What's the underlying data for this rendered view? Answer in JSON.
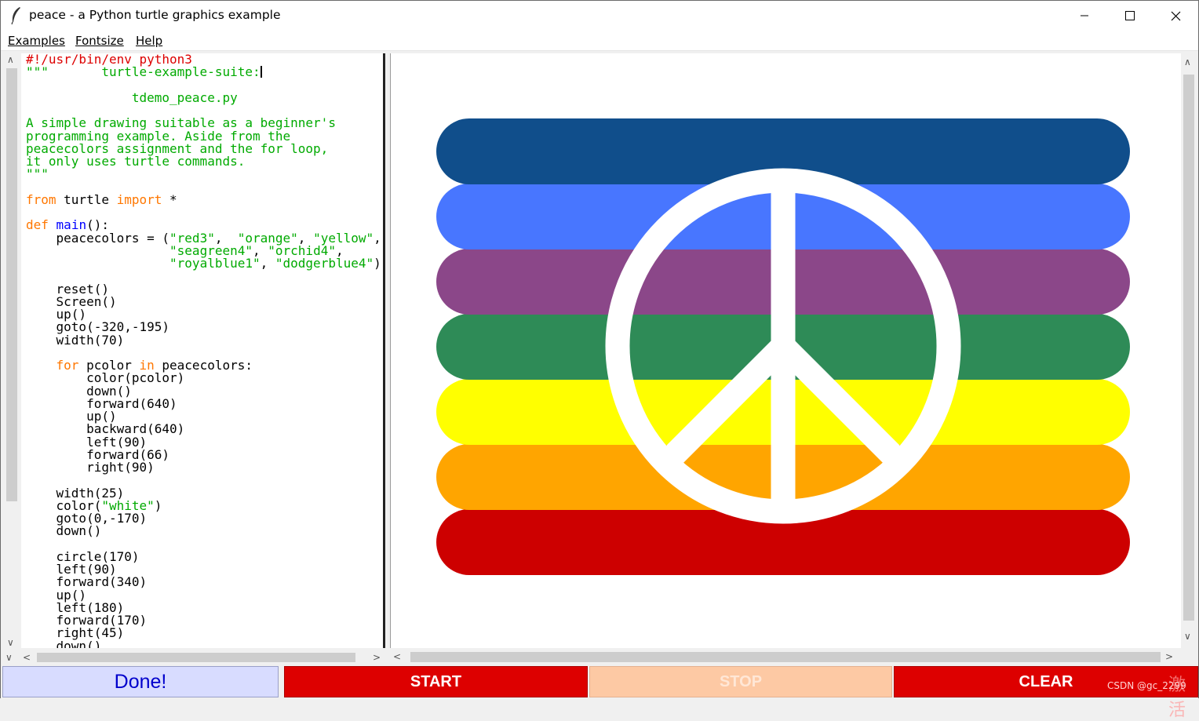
{
  "window": {
    "title": "peace - a Python turtle graphics example",
    "icon": "feather-icon"
  },
  "menu": {
    "examples": "Examples",
    "fontsize": "Fontsize",
    "help": "Help"
  },
  "code_lines": [
    [
      [
        "red",
        "#!/usr/bin/env python3"
      ]
    ],
    [
      [
        "grn",
        "\"\"\"       turtle-example-suite:"
      ],
      [
        "caret",
        ""
      ]
    ],
    [],
    [
      [
        "grn",
        "              tdemo_peace.py"
      ]
    ],
    [],
    [
      [
        "grn",
        "A simple drawing suitable as a beginner's"
      ]
    ],
    [
      [
        "grn",
        "programming example. Aside from the"
      ]
    ],
    [
      [
        "grn",
        "peacecolors assignment and the for loop,"
      ]
    ],
    [
      [
        "grn",
        "it only uses turtle commands."
      ]
    ],
    [
      [
        "grn",
        "\"\"\""
      ]
    ],
    [],
    [
      [
        "org",
        "from"
      ],
      [
        "txt",
        " turtle "
      ],
      [
        "org",
        "import"
      ],
      [
        "txt",
        " *"
      ]
    ],
    [],
    [
      [
        "org",
        "def"
      ],
      [
        "txt",
        " "
      ],
      [
        "blu",
        "main"
      ],
      [
        "txt",
        "():"
      ]
    ],
    [
      [
        "txt",
        "    peacecolors = ("
      ],
      [
        "grn",
        "\"red3\""
      ],
      [
        "txt",
        ",  "
      ],
      [
        "grn",
        "\"orange\""
      ],
      [
        "txt",
        ", "
      ],
      [
        "grn",
        "\"yellow\""
      ],
      [
        "txt",
        ","
      ]
    ],
    [
      [
        "txt",
        "                   "
      ],
      [
        "grn",
        "\"seagreen4\""
      ],
      [
        "txt",
        ", "
      ],
      [
        "grn",
        "\"orchid4\""
      ],
      [
        "txt",
        ","
      ]
    ],
    [
      [
        "txt",
        "                   "
      ],
      [
        "grn",
        "\"royalblue1\""
      ],
      [
        "txt",
        ", "
      ],
      [
        "grn",
        "\"dodgerblue4\""
      ],
      [
        "txt",
        ")"
      ]
    ],
    [],
    [
      [
        "txt",
        "    reset()"
      ]
    ],
    [
      [
        "txt",
        "    Screen()"
      ]
    ],
    [
      [
        "txt",
        "    up()"
      ]
    ],
    [
      [
        "txt",
        "    goto(-320,-195)"
      ]
    ],
    [
      [
        "txt",
        "    width(70)"
      ]
    ],
    [],
    [
      [
        "txt",
        "    "
      ],
      [
        "org",
        "for"
      ],
      [
        "txt",
        " pcolor "
      ],
      [
        "org",
        "in"
      ],
      [
        "txt",
        " peacecolors:"
      ]
    ],
    [
      [
        "txt",
        "        color(pcolor)"
      ]
    ],
    [
      [
        "txt",
        "        down()"
      ]
    ],
    [
      [
        "txt",
        "        forward(640)"
      ]
    ],
    [
      [
        "txt",
        "        up()"
      ]
    ],
    [
      [
        "txt",
        "        backward(640)"
      ]
    ],
    [
      [
        "txt",
        "        left(90)"
      ]
    ],
    [
      [
        "txt",
        "        forward(66)"
      ]
    ],
    [
      [
        "txt",
        "        right(90)"
      ]
    ],
    [],
    [
      [
        "txt",
        "    width(25)"
      ]
    ],
    [
      [
        "txt",
        "    color("
      ],
      [
        "grn",
        "\"white\""
      ],
      [
        "txt",
        ")"
      ]
    ],
    [
      [
        "txt",
        "    goto(0,-170)"
      ]
    ],
    [
      [
        "txt",
        "    down()"
      ]
    ],
    [],
    [
      [
        "txt",
        "    circle(170)"
      ]
    ],
    [
      [
        "txt",
        "    left(90)"
      ]
    ],
    [
      [
        "txt",
        "    forward(340)"
      ]
    ],
    [
      [
        "txt",
        "    up()"
      ]
    ],
    [
      [
        "txt",
        "    left(180)"
      ]
    ],
    [
      [
        "txt",
        "    forward(170)"
      ]
    ],
    [
      [
        "txt",
        "    right(45)"
      ]
    ],
    [
      [
        "txt",
        "    down()"
      ]
    ]
  ],
  "drawing": {
    "stripe_colors_top_to_bottom": [
      "#104e8b",
      "#4876ff",
      "#8b4789",
      "#2e8b57",
      "#ffff00",
      "#ffa500",
      "#cd0000"
    ],
    "symbol_color": "#ffffff"
  },
  "buttons": {
    "done": "Done!",
    "start": "START",
    "stop": "STOP",
    "clear": "CLEAR"
  },
  "watermark": "CSDN @gc_2299",
  "watermark_overlay": "激活"
}
